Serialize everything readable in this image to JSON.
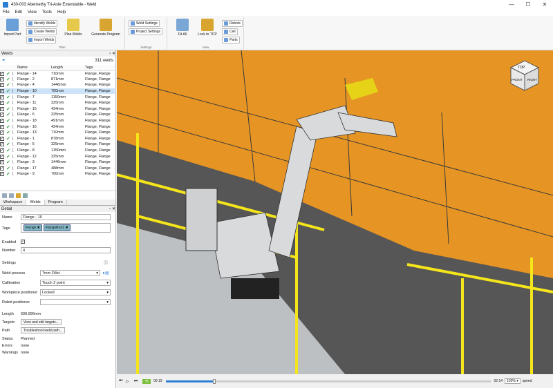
{
  "window": {
    "title": "430-003 Abernethy Tri-Axle Extendable - Weld",
    "minimize": "—",
    "maximize": "☐",
    "close": "✕"
  },
  "menu": [
    "File",
    "Edit",
    "View",
    "Tools",
    "Help"
  ],
  "ribbon": {
    "plan": {
      "import_part": "Import Part",
      "identify_welds": "Identify Welds",
      "create_welds": "Create Welds",
      "import_welds": "Import Welds",
      "plan_welds": "Plan Welds",
      "generate_program": "Generate Program",
      "group_label": "Plan"
    },
    "settings": {
      "weld_settings": "Weld Settings",
      "project_settings": "Project Settings",
      "group_label": "Settings"
    },
    "view": {
      "fit_all": "Fit All",
      "lock_to_tcp": "Lock to TCP",
      "robots": "Robots",
      "cell": "Cell",
      "parts": "Parts",
      "group_label": "View"
    }
  },
  "welds_panel": {
    "title": "Welds",
    "count": "311 welds",
    "columns": [
      "Name",
      "Length",
      "Tags"
    ],
    "rows": [
      {
        "name": "Flange - 14",
        "length": "710mm",
        "tags": "Flange, Flange"
      },
      {
        "name": "Flange - 2",
        "length": "871mm",
        "tags": "Flange, Flange"
      },
      {
        "name": "Flange - 4",
        "length": "1446mm",
        "tags": "Flange, Flange"
      },
      {
        "name": "Flange - 10",
        "length": "700mm",
        "tags": "Flange, Flange"
      },
      {
        "name": "Flange - 7",
        "length": "1150mm",
        "tags": "Flange, Flange"
      },
      {
        "name": "Flange - 11",
        "length": "325mm",
        "tags": "Flange, Flange"
      },
      {
        "name": "Flange - 15",
        "length": "434mm",
        "tags": "Flange, Flange"
      },
      {
        "name": "Flange - 6",
        "length": "325mm",
        "tags": "Flange, Flange"
      },
      {
        "name": "Flange - 18",
        "length": "491mm",
        "tags": "Flange, Flange"
      },
      {
        "name": "Flange - 16",
        "length": "434mm",
        "tags": "Flange, Flange"
      },
      {
        "name": "Flange - 13",
        "length": "710mm",
        "tags": "Flange, Flange"
      },
      {
        "name": "Flange - 1",
        "length": "878mm",
        "tags": "Flange, Flange"
      },
      {
        "name": "Flange - 5",
        "length": "325mm",
        "tags": "Flange, Flange"
      },
      {
        "name": "Flange - 8",
        "length": "1150mm",
        "tags": "Flange, Flange"
      },
      {
        "name": "Flange - 12",
        "length": "325mm",
        "tags": "Flange, Flange"
      },
      {
        "name": "Flange - 3",
        "length": "1446mm",
        "tags": "Flange, Flange"
      },
      {
        "name": "Flange - 17",
        "length": "488mm",
        "tags": "Flange, Flange"
      },
      {
        "name": "Flange - 9",
        "length": "700mm",
        "tags": "Flange, Flange"
      }
    ],
    "tabs": [
      "Workspace",
      "Welds",
      "Program"
    ]
  },
  "detail": {
    "title": "Detail",
    "name_label": "Name",
    "name_value": "Flange - 10",
    "tags_label": "Tags",
    "tags": [
      "Flange",
      "FlangeRun1"
    ],
    "enabled_label": "Enabled",
    "number_label": "Number",
    "number_value": "4",
    "settings_label": "Settings",
    "weld_process_label": "Weld process",
    "weld_process_value": "7mm Fillet",
    "calibration_label": "Calibration",
    "calibration_value": "Touch 2 point",
    "workpiece_label": "Workpiece positioner",
    "workpiece_value": "Locked",
    "robot_positioner_label": "Robot positioner",
    "robot_positioner_value": "",
    "length_label": "Length",
    "length_value": "699.996mm",
    "targets_label": "Targets",
    "targets_button": "View and edit targets...",
    "path_label": "Path",
    "path_button": "Troubleshoot weld path...",
    "status_label": "Status",
    "status_value": "Planned",
    "errors_label": "Errors",
    "errors_value": "none",
    "warnings_label": "Warnings",
    "warnings_value": "none"
  },
  "viewcube": {
    "top": "TOP",
    "front": "FRONT",
    "right": "RIGHT"
  },
  "playback": {
    "current": "00:19",
    "total": "02:14",
    "progress": 0.15,
    "zoom": "100%",
    "speed_label": "speed"
  },
  "colors": {
    "frame": "#f29a1f",
    "fence": "#f5e51b",
    "floor": "#555555"
  }
}
